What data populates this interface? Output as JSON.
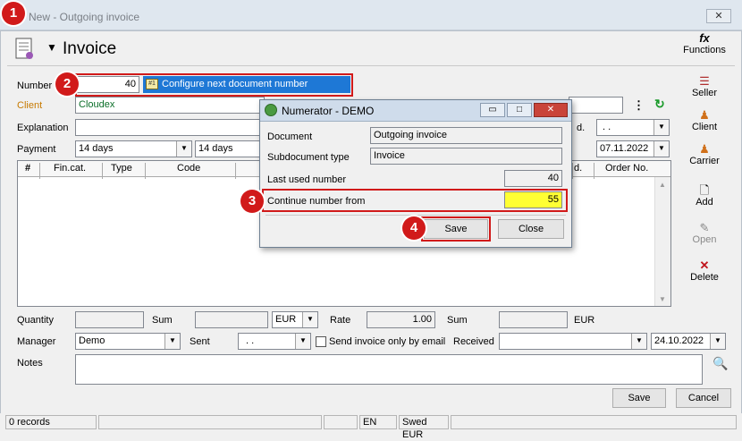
{
  "window": {
    "title": "New - Outgoing invoice",
    "close_glyph": "✕"
  },
  "header": {
    "title": "Invoice",
    "dropdown_glyph": "▼",
    "functions_label": "Functions",
    "functions_icon": "fx-icon"
  },
  "form": {
    "number_label": "Number",
    "number_value": "40",
    "configure_label": "Configure next document number",
    "client_label": "Client",
    "client_value": "Cloudex",
    "explanation_label": "Explanation",
    "explanation_value": "",
    "payment_label": "Payment",
    "payment_value1": "14 days",
    "payment_value2": "14 days",
    "right_label_d": "d.",
    "right_date1": ". .",
    "right_date2": "07.11.2022"
  },
  "grid": {
    "headers": [
      "#",
      "Fin.cat.",
      "Type",
      "Code"
    ],
    "right_headers": [
      "d.",
      "Order No."
    ]
  },
  "side_buttons": [
    {
      "label": "Seller",
      "icon": "seller-icon"
    },
    {
      "label": "Client",
      "icon": "client-icon"
    },
    {
      "label": "Carrier",
      "icon": "carrier-icon"
    },
    {
      "label": "Add",
      "icon": "add-document-icon"
    },
    {
      "label": "Open",
      "icon": "open-icon"
    },
    {
      "label": "Delete",
      "icon": "delete-icon"
    }
  ],
  "totals": {
    "quantity_label": "Quantity",
    "sum_label": "Sum",
    "currency": "EUR",
    "rate_label": "Rate",
    "rate_value": "1.00",
    "sum2_label": "Sum",
    "currency2": "EUR"
  },
  "bottom": {
    "manager_label": "Manager",
    "manager_value": "Demo",
    "sent_label": "Sent",
    "sent_value": ". .",
    "send_email_label": "Send invoice only by email",
    "received_label": "Received",
    "received_value": "",
    "date_value": "24.10.2022",
    "notes_label": "Notes",
    "save_label": "Save",
    "cancel_label": "Cancel"
  },
  "status": {
    "records": "0 records",
    "lang": "EN",
    "currency": "Swed EUR"
  },
  "dialog": {
    "title": "Numerator - DEMO",
    "document_label": "Document",
    "document_value": "Outgoing invoice",
    "subtype_label": "Subdocument type",
    "subtype_value": "Invoice",
    "last_used_label": "Last used number",
    "last_used_value": "40",
    "continue_label": "Continue number from",
    "continue_value": "55",
    "save_label": "Save",
    "close_label": "Close",
    "min_glyph": "▭",
    "max_glyph": "□",
    "close_glyph": "✕"
  },
  "badges": [
    "1",
    "2",
    "3",
    "4"
  ],
  "colors": {
    "highlight": "#1e78d6",
    "annotation_red": "#d11a1a",
    "input_yellow": "#ffff33",
    "client_label": "#c77a00"
  }
}
